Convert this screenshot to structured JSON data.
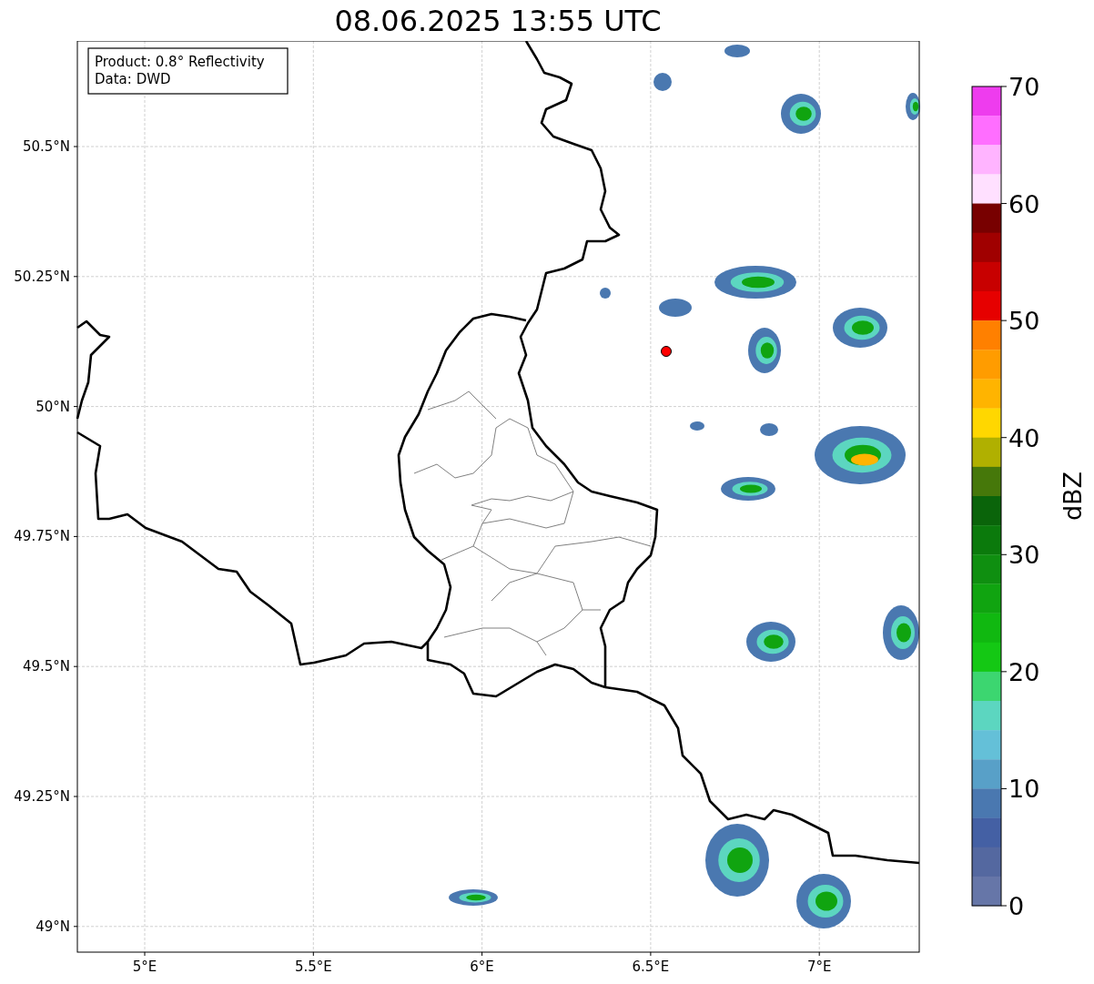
{
  "title": "08.06.2025 13:55 UTC",
  "annotation": [
    "Product: 0.8° Reflectivity",
    "Data: DWD"
  ],
  "map": {
    "lat_ticks": [
      "50.5°N",
      "50.25°N",
      "50°N",
      "49.75°N",
      "49.5°N",
      "49.25°N",
      "49°N"
    ],
    "lon_ticks": [
      "5°E",
      "5.5°E",
      "6°E",
      "6.5°E",
      "7°E"
    ]
  },
  "colorbar": {
    "label": "dBZ",
    "ticks": [
      "70",
      "60",
      "50",
      "40",
      "30",
      "20",
      "10",
      "0"
    ],
    "bins": [
      {
        "color": "#ee3cee"
      },
      {
        "color": "#ff6eff"
      },
      {
        "color": "#ffb4ff"
      },
      {
        "color": "#ffe0ff"
      },
      {
        "color": "#780000"
      },
      {
        "color": "#a00000"
      },
      {
        "color": "#c80000"
      },
      {
        "color": "#e60000"
      },
      {
        "color": "#ff8000"
      },
      {
        "color": "#ff9c00"
      },
      {
        "color": "#ffb400"
      },
      {
        "color": "#ffd700"
      },
      {
        "color": "#b0b000"
      },
      {
        "color": "#46780a"
      },
      {
        "color": "#0a640a"
      },
      {
        "color": "#0b7a0c"
      },
      {
        "color": "#0f8f10"
      },
      {
        "color": "#10a410"
      },
      {
        "color": "#10b810"
      },
      {
        "color": "#14c814"
      },
      {
        "color": "#3cd670"
      },
      {
        "color": "#5cd6c0"
      },
      {
        "color": "#64c0d8"
      },
      {
        "color": "#58a0c8"
      },
      {
        "color": "#4a78b0"
      },
      {
        "color": "#4460a4"
      },
      {
        "color": "#5468a0"
      },
      {
        "color": "#6676a8"
      }
    ]
  }
}
